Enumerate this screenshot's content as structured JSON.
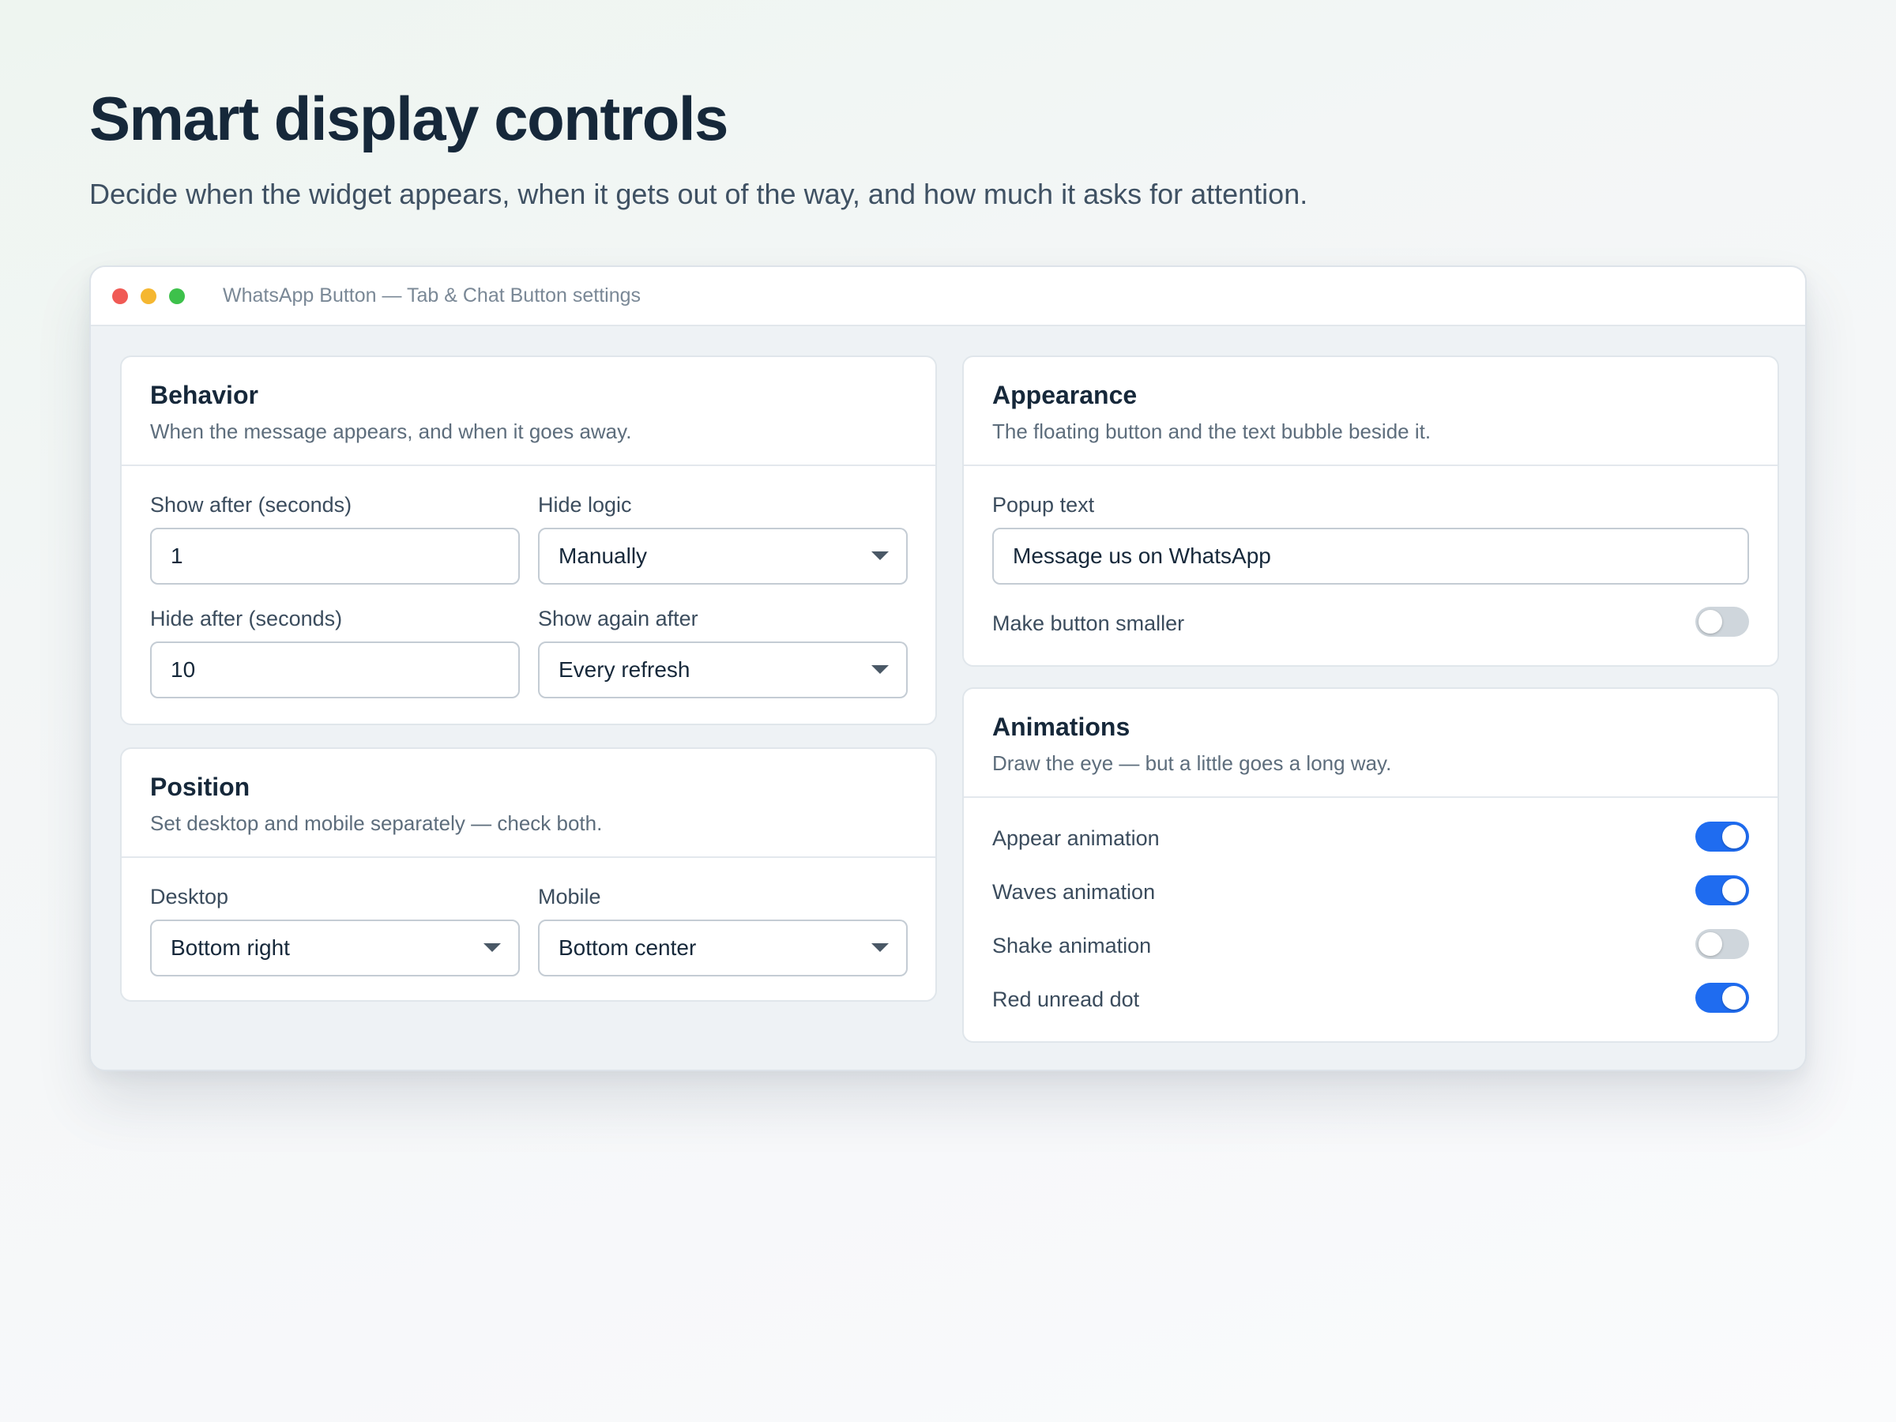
{
  "page": {
    "headline": "Smart display controls",
    "subhead": "Decide when the widget appears, when it gets out of the way, and how much it asks for attention."
  },
  "window": {
    "title": "WhatsApp Button — Tab & Chat Button settings"
  },
  "behavior": {
    "title": "Behavior",
    "description": "When the message appears, and when it goes away.",
    "show_after_label": "Show after (seconds)",
    "show_after_value": "1",
    "hide_logic_label": "Hide logic",
    "hide_logic_value": "Manually",
    "hide_after_label": "Hide after (seconds)",
    "hide_after_value": "10",
    "show_again_label": "Show again after",
    "show_again_value": "Every refresh"
  },
  "position": {
    "title": "Position",
    "description": "Set desktop and mobile separately — check both.",
    "desktop_label": "Desktop",
    "desktop_value": "Bottom right",
    "mobile_label": "Mobile",
    "mobile_value": "Bottom center"
  },
  "appearance": {
    "title": "Appearance",
    "description": "The floating button and the text bubble beside it.",
    "popup_text_label": "Popup text",
    "popup_text_value": "Message us on WhatsApp",
    "smaller_label": "Make button smaller",
    "smaller_on": false
  },
  "animations": {
    "title": "Animations",
    "description": "Draw the eye — but a little goes a long way.",
    "items": [
      {
        "label": "Appear animation",
        "on": true
      },
      {
        "label": "Waves animation",
        "on": true
      },
      {
        "label": "Shake animation",
        "on": false
      },
      {
        "label": "Red unread dot",
        "on": true
      }
    ]
  },
  "colors": {
    "toggle_on": "#1f6cf0",
    "toggle_off": "#cfd6dc",
    "traffic_red": "#f05a55",
    "traffic_yellow": "#f5b731",
    "traffic_green": "#3dc14b"
  }
}
